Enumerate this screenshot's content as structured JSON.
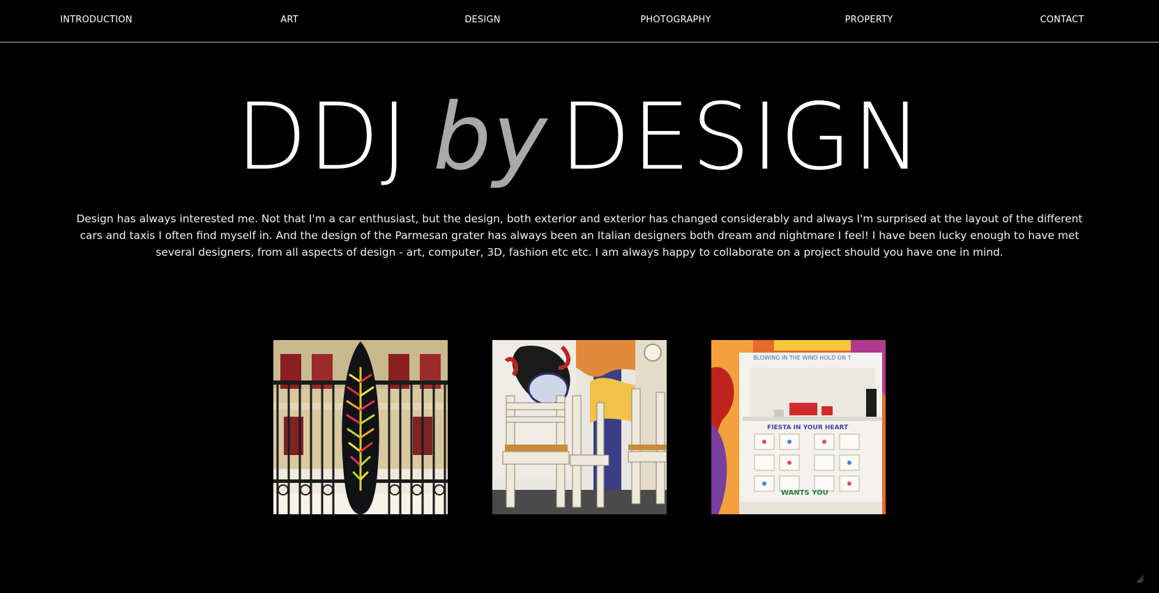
{
  "nav": {
    "items": [
      {
        "label": "INTRODUCTION"
      },
      {
        "label": "ART"
      },
      {
        "label": "DESIGN"
      },
      {
        "label": "PHOTOGRAPHY"
      },
      {
        "label": "PROPERTY"
      },
      {
        "label": "CONTACT"
      }
    ]
  },
  "hero": {
    "title_part1": "DDJ",
    "title_part2": "by",
    "title_part3": "DESIGN"
  },
  "intro": {
    "text": "Design has always interested me. Not that I'm a car enthusiast, but the design, both exterior and exterior has changed considerably and always I'm surprised at the layout of the different cars and taxis I often find myself in. And the design of the Parmesan grater has always been an Italian designers both dream and nightmare I feel! I have been lucky enough to have met several designers, from all aspects of design - art, computer, 3D, fashion etc etc. I am always happy to collaborate on a project should you have one in mind."
  },
  "gallery": {
    "images": [
      {
        "icon": "painted-surfboard-image"
      },
      {
        "icon": "painted-chairs-image"
      },
      {
        "icon": "painted-cabinet-image"
      }
    ],
    "cabinet_text": {
      "top": "BLOWING IN THE WIND  HOLD ON T",
      "middle": "FIESTA IN YOUR HEART",
      "bottom": "WANTS YOU"
    }
  },
  "colors": {
    "background": "#000000",
    "text": "#ffffff",
    "accent": "#a9a9a9"
  }
}
